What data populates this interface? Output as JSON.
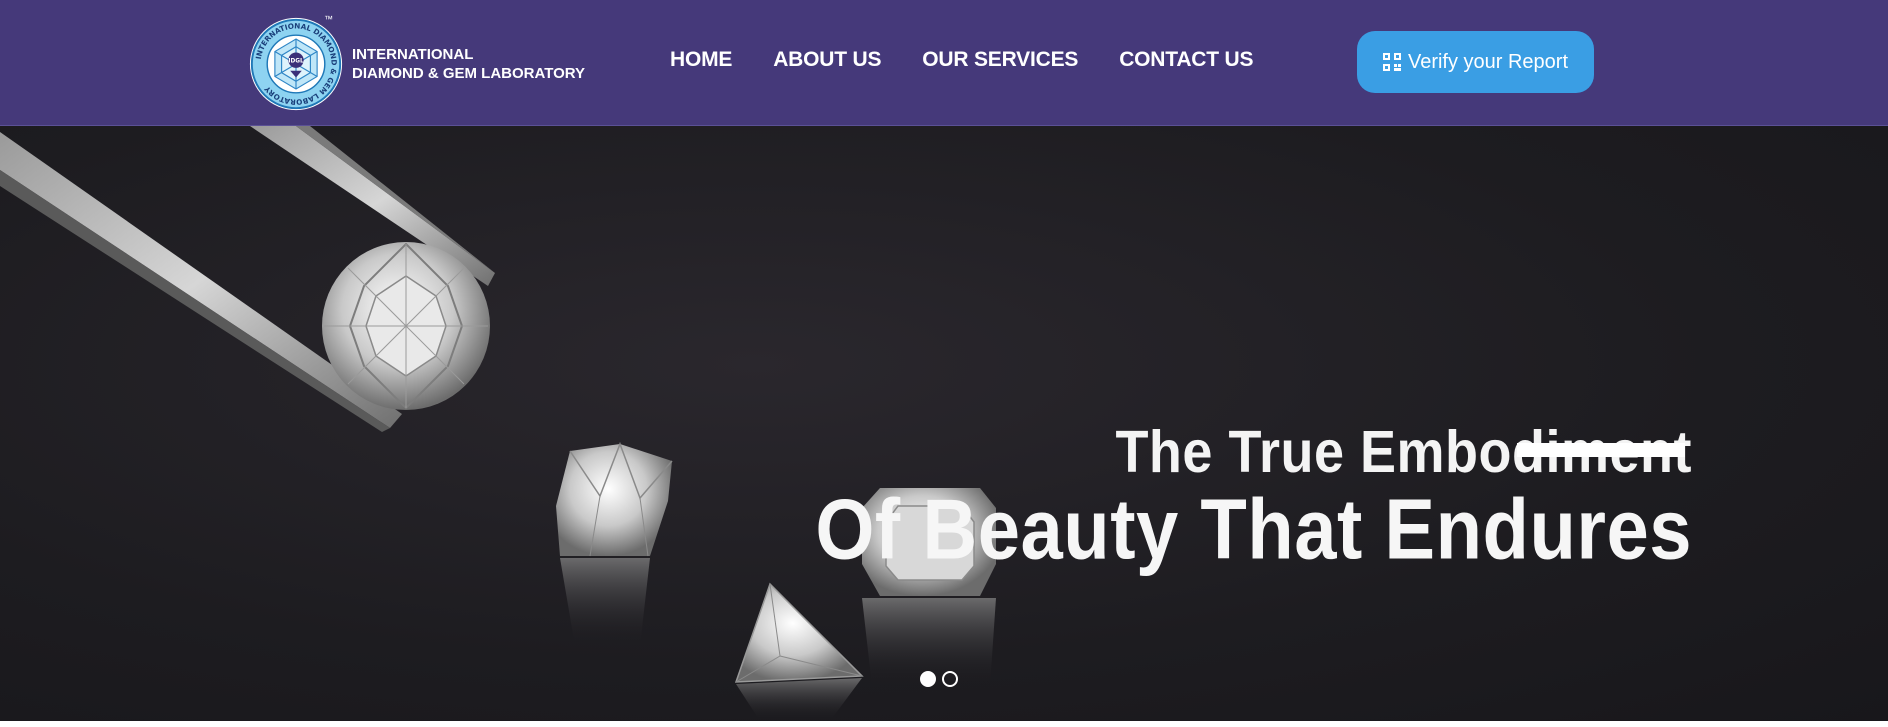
{
  "header": {
    "logo": {
      "seal_text": "INTERNATIONAL DIAMOND & GEM LABORATORY",
      "seal_center": "IDGL",
      "trademark": "™",
      "line1": "INTERNATIONAL",
      "line2": "DIAMOND & GEM LABORATORY"
    },
    "nav": [
      {
        "label": "HOME"
      },
      {
        "label": "ABOUT US"
      },
      {
        "label": "OUR SERVICES"
      },
      {
        "label": "CONTACT US"
      }
    ],
    "verify_button": {
      "label": "Verify your Report",
      "icon": "qr-code-icon"
    }
  },
  "hero": {
    "headline_line1": "The True Embodiment",
    "headline_line2": "Of Beauty That Endures",
    "slides": {
      "count": 2,
      "active": 1
    }
  },
  "colors": {
    "header_bg": "#45397a",
    "button_bg": "#3a9ee4",
    "hero_bg": "#1d1c20",
    "text": "#ffffff"
  }
}
